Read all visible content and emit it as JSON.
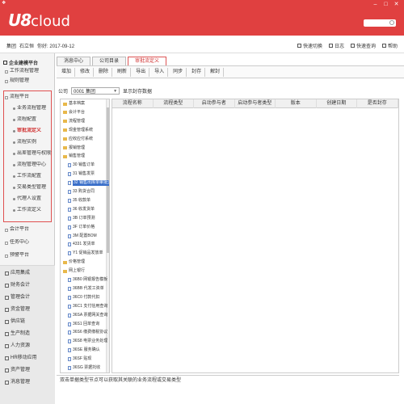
{
  "window": {
    "mark": "❖",
    "logo_u8": "U8",
    "logo_cloud": "cloud",
    "controls": [
      "–",
      "□",
      "✕"
    ]
  },
  "infobar": {
    "company": "集团",
    "org": "石立恒",
    "date_label": "你好: 2017-09-12",
    "links": [
      "快速切换",
      "日志",
      "快速查询",
      "帮助"
    ]
  },
  "leftnav": {
    "header": "企业建模平台",
    "items": [
      {
        "label": "工作流程管理"
      },
      {
        "label": "规则管理"
      },
      {
        "label": "流程平台"
      },
      {
        "label": "业务流程管理"
      },
      {
        "label": "流程配置"
      },
      {
        "label": "审批流定义"
      },
      {
        "label": "流程实例"
      },
      {
        "label": "出差管理与权限设置"
      },
      {
        "label": "流程管理中心"
      },
      {
        "label": "工作流配置"
      },
      {
        "label": "交易类型管理"
      },
      {
        "label": "代理人设置"
      },
      {
        "label": "工作流定义"
      },
      {
        "label": "会计平台"
      },
      {
        "label": "任务中心"
      },
      {
        "label": "预警平台"
      }
    ],
    "modules": [
      "应用集成",
      "财务会计",
      "管理会计",
      "资金管理",
      "供应链",
      "生产制造",
      "人力资源",
      "HR移动应用",
      "资产管理",
      "消息管理"
    ]
  },
  "tabs": [
    {
      "label": "消息中心"
    },
    {
      "label": "公司目录"
    },
    {
      "label": "审批流定义"
    }
  ],
  "toolbar": [
    "增加",
    "修改",
    "删除",
    "刷新",
    "导出",
    "导入",
    "同步",
    "封存",
    "解封"
  ],
  "filter": {
    "company_label": "公司",
    "company_value": "0001  集团",
    "show_sealed": "显示封存数据"
  },
  "tree": [
    {
      "label": "基本档案",
      "type": "folder",
      "indent": 0
    },
    {
      "label": "会计平台",
      "type": "folder",
      "indent": 0
    },
    {
      "label": "流程管理",
      "type": "folder",
      "indent": 0
    },
    {
      "label": "现金管理系统",
      "type": "folder",
      "indent": 0
    },
    {
      "label": "应收应付系统",
      "type": "folder",
      "indent": 0
    },
    {
      "label": "报销管理",
      "type": "folder",
      "indent": 0
    },
    {
      "label": "销售管理",
      "type": "folder",
      "indent": 0
    },
    {
      "label": "30 销售订单",
      "type": "doc",
      "indent": 1
    },
    {
      "label": "31 销售发票",
      "type": "doc",
      "indent": 1
    },
    {
      "label": "32 销售出库单审批流",
      "type": "doc",
      "indent": 1,
      "selected": true
    },
    {
      "label": "33 购货合同",
      "type": "doc",
      "indent": 1
    },
    {
      "label": "35 收款单",
      "type": "doc",
      "indent": 1
    },
    {
      "label": "36 收发货单",
      "type": "doc",
      "indent": 1
    },
    {
      "label": "3B 订单预测",
      "type": "doc",
      "indent": 1
    },
    {
      "label": "3F 订单价格",
      "type": "doc",
      "indent": 1
    },
    {
      "label": "3M 配置BOM",
      "type": "doc",
      "indent": 1
    },
    {
      "label": "4331 发货单",
      "type": "doc",
      "indent": 1
    },
    {
      "label": "Y1 促销品发放单",
      "type": "doc",
      "indent": 1
    },
    {
      "label": "价格管理",
      "type": "folder",
      "indent": 0
    },
    {
      "label": "网上银行",
      "type": "folder",
      "indent": 0
    },
    {
      "label": "36B0 网银报告模板",
      "type": "doc",
      "indent": 1
    },
    {
      "label": "36BB 代发工资单",
      "type": "doc",
      "indent": 1
    },
    {
      "label": "36C0 付款代扣",
      "type": "doc",
      "indent": 1
    },
    {
      "label": "36C1 支付信用查询",
      "type": "doc",
      "indent": 1
    },
    {
      "label": "36SA 票据网关查询",
      "type": "doc",
      "indent": 1
    },
    {
      "label": "36S1 回单查询",
      "type": "doc",
      "indent": 1
    },
    {
      "label": "36S6 缴费缴税协议",
      "type": "doc",
      "indent": 1
    },
    {
      "label": "36S8 电票业务处理",
      "type": "doc",
      "indent": 1
    },
    {
      "label": "36SE 服务确认",
      "type": "doc",
      "indent": 1
    },
    {
      "label": "36SF 贴现",
      "type": "doc",
      "indent": 1
    },
    {
      "label": "36SG 票据托收",
      "type": "doc",
      "indent": 1
    }
  ],
  "grid_columns": [
    "流程名称",
    "流程类型",
    "启动参与者",
    "启动参与者类型",
    "版本",
    "创建日期",
    "是否封存"
  ],
  "status": "双击单据类型节点可以获取其关联的业务流程或交易类型"
}
